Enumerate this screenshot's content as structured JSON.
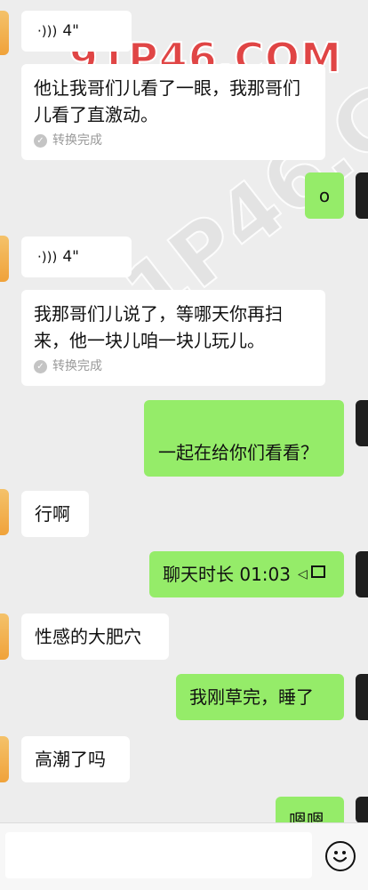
{
  "watermark": "91P46.COM",
  "messages": [
    {
      "id": "m1",
      "side": "in",
      "type": "voice",
      "duration": "4\""
    },
    {
      "id": "m2",
      "side": "in",
      "type": "text",
      "text": "他让我哥们儿看了一眼，我那哥们儿看了直激动。",
      "converted": "转换完成"
    },
    {
      "id": "m3",
      "side": "out",
      "type": "text",
      "text": "o"
    },
    {
      "id": "m4",
      "side": "in",
      "type": "voice",
      "duration": "4\""
    },
    {
      "id": "m5",
      "side": "in",
      "type": "text",
      "text": "我那哥们儿说了，等哪天你再扫来，他一块儿咱一块儿玩儿。",
      "converted": "转换完成"
    },
    {
      "id": "m6",
      "side": "out",
      "type": "text",
      "text": "一起在给你们看看？"
    },
    {
      "id": "m7",
      "side": "in",
      "type": "text",
      "text": "行啊"
    },
    {
      "id": "m8",
      "side": "out",
      "type": "call",
      "text": "聊天时长 01:03"
    },
    {
      "id": "m9",
      "side": "in",
      "type": "text",
      "text": "性感的大肥穴"
    },
    {
      "id": "m10",
      "side": "out",
      "type": "text",
      "text": "我刚草完，睡了"
    },
    {
      "id": "m11",
      "side": "in",
      "type": "text",
      "text": "高潮了吗"
    },
    {
      "id": "m12",
      "side": "out",
      "type": "text",
      "text": "嗯嗯"
    }
  ],
  "icons": {
    "voice": "voice-wave-icon",
    "call": "video-call-icon",
    "emoji": "emoji-icon",
    "converted": "check-icon"
  }
}
